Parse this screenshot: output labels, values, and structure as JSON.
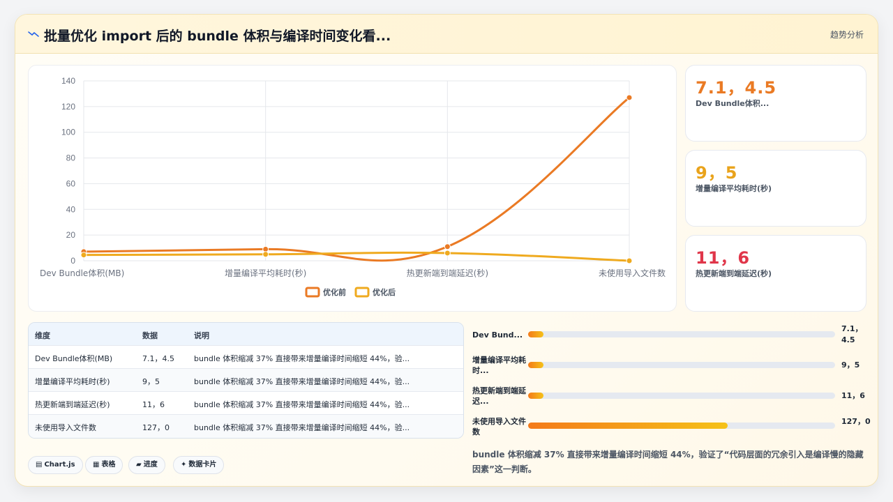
{
  "header": {
    "title": "批量优化 import 后的 bundle 体积与编译时间变化看...",
    "tag": "趋势分析"
  },
  "chart_data": {
    "type": "line",
    "categories": [
      "Dev Bundle体积(MB)",
      "增量编译平均耗时(秒)",
      "热更新端到端延迟(秒)",
      "未使用导入文件数"
    ],
    "series": [
      {
        "name": "优化前",
        "values": [
          7.1,
          9,
          11,
          127
        ],
        "color": "#ea7a24"
      },
      {
        "name": "优化后",
        "values": [
          4.5,
          5,
          6,
          0
        ],
        "color": "#efaa1f"
      }
    ],
    "ylim": [
      0,
      140
    ],
    "yticks": [
      0,
      20,
      40,
      60,
      80,
      100,
      120,
      140
    ],
    "grid": true,
    "legend": "bottom"
  },
  "stats": [
    {
      "value": "7.1，4.5",
      "label": "Dev Bundle体积...",
      "color": "#ea7a24"
    },
    {
      "value": "9，5",
      "label": "增量编译平均耗时(秒)",
      "color": "#e9a31b"
    },
    {
      "value": "11，6",
      "label": "热更新端到端延迟(秒)",
      "color": "#e0364a"
    }
  ],
  "table": {
    "headers": [
      "维度",
      "数据",
      "说明"
    ],
    "rows": [
      [
        "Dev Bundle体积(MB)",
        "7.1，4.5",
        "bundle 体积缩减 37% 直接带来增量编译时间缩短 44%，验..."
      ],
      [
        "增量编译平均耗时(秒)",
        "9，5",
        "bundle 体积缩减 37% 直接带来增量编译时间缩短 44%，验..."
      ],
      [
        "热更新端到端延迟(秒)",
        "11，6",
        "bundle 体积缩减 37% 直接带来增量编译时间缩短 44%，验..."
      ],
      [
        "未使用导入文件数",
        "127，0",
        "bundle 体积缩减 37% 直接带来增量编译时间缩短 44%，验..."
      ]
    ]
  },
  "progress": [
    {
      "label": "Dev Bund...",
      "value": "7.1，4.5",
      "fraction": 0.05
    },
    {
      "label": "增量编译平均耗时...",
      "value": "9，5",
      "fraction": 0.05
    },
    {
      "label": "热更新端到端延迟...",
      "value": "11，6",
      "fraction": 0.05
    },
    {
      "label": "未使用导入文件数",
      "value": "127，0",
      "fraction": 0.65
    }
  ],
  "summary": "bundle 体积缩减 37% 直接带来增量编译时间缩短 44%，验证了“代码层面的冗余引入是编译慢的隐藏因素”这一判断。",
  "chips": [
    {
      "icon": "▤",
      "label": "Chart.js"
    },
    {
      "icon": "▦",
      "label": "表格"
    },
    {
      "icon": "▰",
      "label": "进度"
    },
    {
      "icon": "✦",
      "label": "数据卡片"
    }
  ]
}
